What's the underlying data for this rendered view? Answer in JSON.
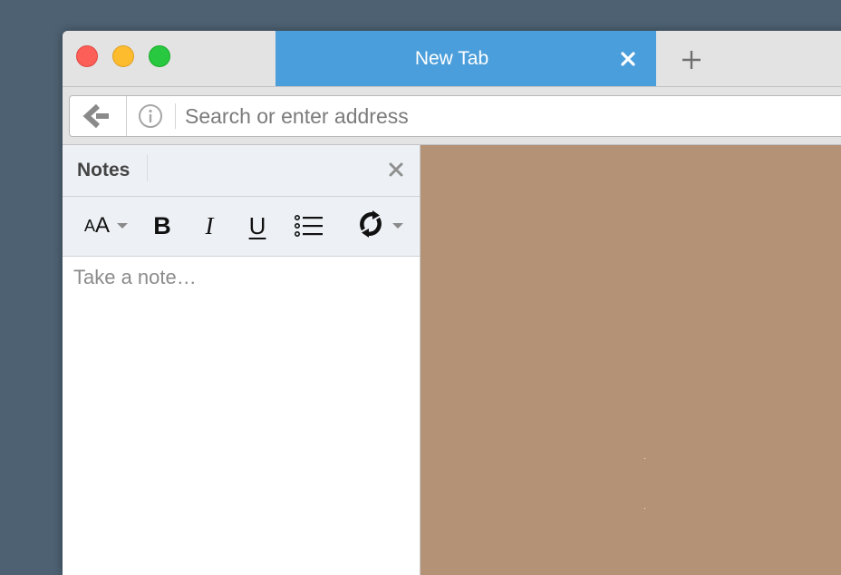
{
  "window": {
    "controls": {
      "close": "close-window-icon",
      "minimize": "minimize-window-icon",
      "maximize": "maximize-window-icon"
    }
  },
  "tabs": [
    {
      "title": "New Tab",
      "active": true,
      "close_icon": "close-icon"
    }
  ],
  "new_tab_icon": "plus-icon",
  "navbar": {
    "back_icon": "back-arrow-icon",
    "info_icon": "info-icon",
    "address_placeholder": "Search or enter address",
    "address_value": ""
  },
  "sidebar": {
    "title": "Notes",
    "close_icon": "close-icon",
    "toolbar": {
      "font_size_small": "A",
      "font_size_large": "A",
      "bold": "B",
      "italic": "I",
      "underline": "U",
      "list_icon": "bulleted-list-icon",
      "sync_icon": "sync-icon"
    },
    "note_placeholder": "Take a note…",
    "note_value": ""
  },
  "colors": {
    "desktop": "#4d6172",
    "active_tab": "#4a9edb",
    "content_background": "#b39276",
    "sidebar_header": "#edf1f5"
  }
}
